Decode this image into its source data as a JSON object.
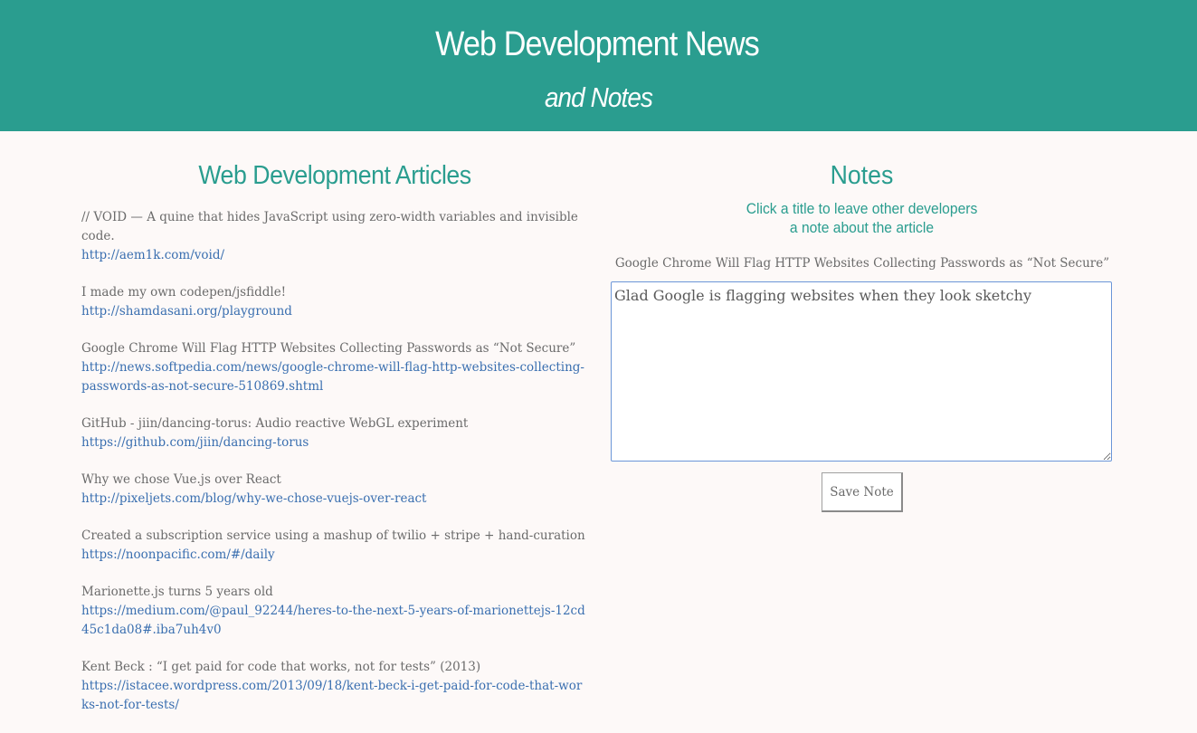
{
  "header": {
    "title": "Web Development News",
    "subtitle": "and Notes"
  },
  "articles": {
    "heading": "Web Development Articles",
    "items": [
      {
        "title": "// VOID — A quine that hides JavaScript using zero-width variables and invisible code.",
        "url": "http://aem1k.com/void/"
      },
      {
        "title": "I made my own codepen/jsfiddle!",
        "url": "http://shamdasani.org/playground"
      },
      {
        "title": "Google Chrome Will Flag HTTP Websites Collecting Passwords as “Not Secure”",
        "url": "http://news.softpedia.com/news/google-chrome-will-flag-http-websites-collecting-passwords-as-not-secure-510869.shtml"
      },
      {
        "title": "GitHub - jiin/dancing-torus: Audio reactive WebGL experiment",
        "url": "https://github.com/jiin/dancing-torus"
      },
      {
        "title": "Why we chose Vue.js over React",
        "url": "http://pixeljets.com/blog/why-we-chose-vuejs-over-react"
      },
      {
        "title": "Created a subscription service using a mashup of twilio + stripe + hand-curation",
        "url": "https://noonpacific.com/#/daily"
      },
      {
        "title": "Marionette.js turns 5 years old",
        "url": "https://medium.com/@paul_92244/heres-to-the-next-5-years-of-marionettejs-12cd45c1da08#.iba7uh4v0"
      },
      {
        "title": "Kent Beck : “I get paid for code that works, not for tests” (2013)",
        "url": "https://istacee.wordpress.com/2013/09/18/kent-beck-i-get-paid-for-code-that-works-not-for-tests/"
      }
    ]
  },
  "notes": {
    "heading": "Notes",
    "instruction_line1": "Click a title to leave other developers",
    "instruction_line2": "a note about the article",
    "selected_title": "Google Chrome Will Flag HTTP Websites Collecting Passwords as “Not Secure”",
    "note_value": "Glad Google is flagging websites when they look sketchy",
    "save_label": "Save Note"
  },
  "colors": {
    "accent": "#2a9d8f",
    "link": "#3a6fb0",
    "text": "#6b6b6b",
    "background": "#fdf9f8"
  }
}
